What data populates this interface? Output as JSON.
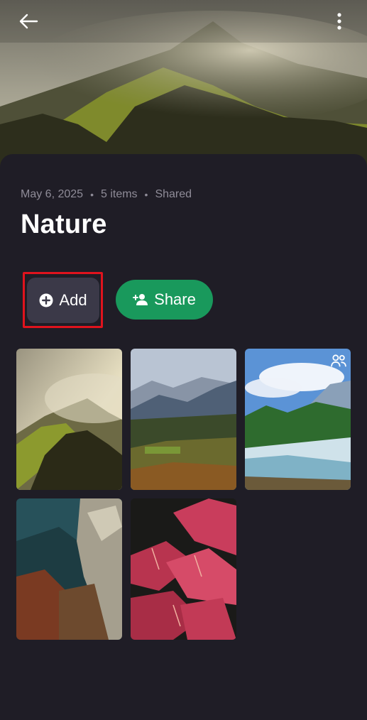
{
  "album": {
    "date": "May 6, 2025",
    "item_count": "5 items",
    "visibility": "Shared",
    "separator": "•",
    "title": "Nature"
  },
  "actions": {
    "add_label": "Add",
    "share_label": "Share"
  },
  "icons": {
    "back": "arrow-left-icon",
    "more": "more-vertical-icon",
    "add": "plus-circle-icon",
    "share": "add-person-icon",
    "shared_badge": "people-icon"
  },
  "photos": [
    {
      "subject": "foggy forested hill at sunrise"
    },
    {
      "subject": "mountain valley with autumn forest"
    },
    {
      "subject": "river rapids below pine forest",
      "shared": true
    },
    {
      "subject": "rocky coastline from above"
    },
    {
      "subject": "red leaves close-up"
    }
  ],
  "colors": {
    "background": "#1f1d26",
    "add_button": "#3b3948",
    "share_button": "#19995c",
    "highlight": "#e0131d",
    "meta_text": "#8f8c98"
  }
}
